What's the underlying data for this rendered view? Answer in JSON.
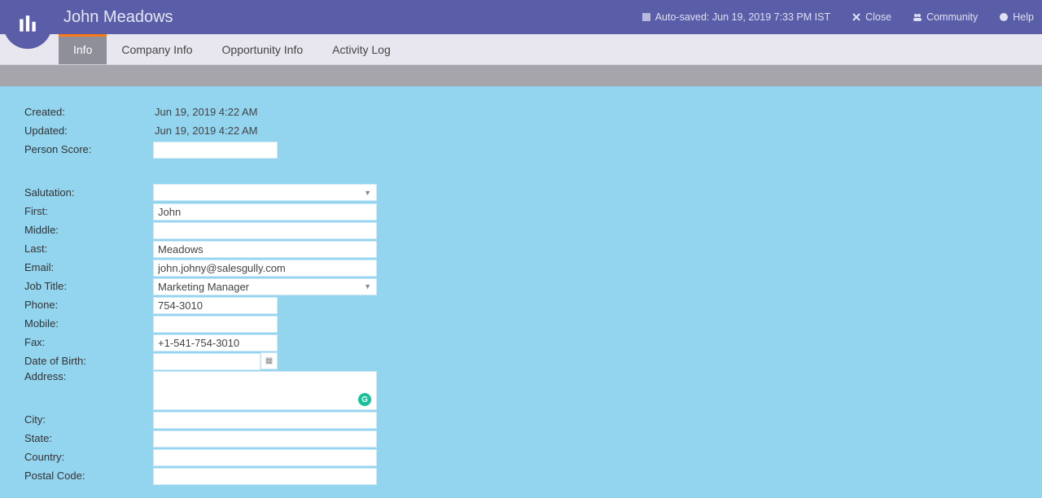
{
  "header": {
    "title": "John Meadows",
    "autosave": "Auto-saved: Jun 19, 2019 7:33 PM IST",
    "close": "Close",
    "community": "Community",
    "help": "Help"
  },
  "tabs": {
    "info": "Info",
    "company": "Company Info",
    "opportunity": "Opportunity Info",
    "activity": "Activity Log"
  },
  "meta": {
    "created_label": "Created:",
    "created_value": "Jun 19, 2019 4:22 AM",
    "updated_label": "Updated:",
    "updated_value": "Jun 19, 2019 4:22 AM",
    "person_score_label": "Person Score:",
    "person_score_value": ""
  },
  "form": {
    "salutation_label": "Salutation:",
    "salutation_value": "",
    "first_label": "First:",
    "first_value": "John",
    "middle_label": "Middle:",
    "middle_value": "",
    "last_label": "Last:",
    "last_value": "Meadows",
    "email_label": "Email:",
    "email_value": "john.johny@salesgully.com",
    "jobtitle_label": "Job Title:",
    "jobtitle_value": "Marketing Manager",
    "phone_label": "Phone:",
    "phone_value": "754-3010",
    "mobile_label": "Mobile:",
    "mobile_value": "",
    "fax_label": "Fax:",
    "fax_value": "+1-541-754-3010",
    "dob_label": "Date of Birth:",
    "dob_value": "",
    "address_label": "Address:",
    "address_value": "",
    "city_label": "City:",
    "city_value": "",
    "state_label": "State:",
    "state_value": "",
    "country_label": "Country:",
    "country_value": "",
    "postal_label": "Postal Code:",
    "postal_value": ""
  }
}
